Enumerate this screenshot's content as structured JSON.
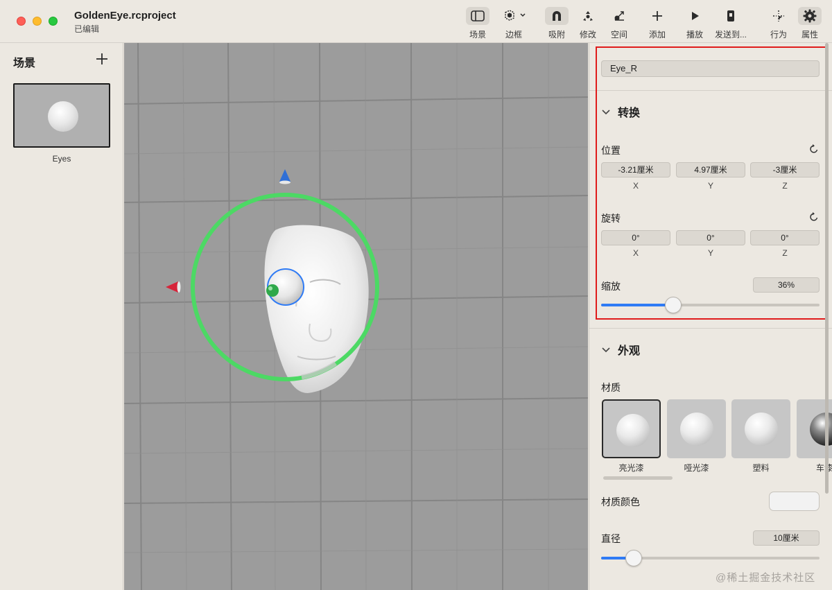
{
  "window": {
    "title": "GoldenEye.rcproject",
    "subtitle": "已编辑",
    "traffic_lights": [
      "close",
      "minimize",
      "zoom"
    ]
  },
  "toolbar": {
    "items": [
      {
        "label": "场景",
        "icon": "sidebar-icon"
      },
      {
        "label": "边框",
        "icon": "cube-frame-icon"
      },
      {
        "label": "吸附",
        "icon": "magnet-icon",
        "pressed": true
      },
      {
        "label": "修改",
        "icon": "transform-icon"
      },
      {
        "label": "空间",
        "icon": "space-icon"
      },
      {
        "label": "添加",
        "icon": "plus-icon"
      },
      {
        "label": "播放",
        "icon": "play-icon"
      },
      {
        "label": "发送到...",
        "icon": "send-icon"
      },
      {
        "label": "行为",
        "icon": "behavior-icon"
      },
      {
        "label": "属性",
        "icon": "gear-icon",
        "pressed": true
      }
    ]
  },
  "scenes": {
    "header": "场景",
    "items": [
      {
        "label": "Eyes",
        "selected": true
      }
    ]
  },
  "inspector": {
    "object_name": "Eye_R",
    "transform": {
      "title": "转换",
      "position": {
        "label": "位置",
        "x": "-3.21厘米",
        "y": "4.97厘米",
        "z": "-3厘米"
      },
      "rotation": {
        "label": "旋转",
        "x": "0°",
        "y": "0°",
        "z": "0°"
      },
      "axes": [
        "X",
        "Y",
        "Z"
      ],
      "scale": {
        "label": "缩放",
        "value": "36%",
        "fraction": 0.33
      }
    },
    "appearance": {
      "title": "外观",
      "material_label": "材质",
      "materials": [
        "亮光漆",
        "哑光漆",
        "塑料",
        "车漆"
      ],
      "selected_material": "亮光漆",
      "color_label": "材质颜色",
      "color": "#f2f2f2",
      "diameter": {
        "label": "直径",
        "value": "10厘米",
        "fraction": 0.15
      }
    }
  },
  "watermark": "@稀土掘金技术社区",
  "colors": {
    "accent": "#2f7bf5",
    "highlight_box": "#e01b1b",
    "rotation_ring": "#4cd964"
  }
}
